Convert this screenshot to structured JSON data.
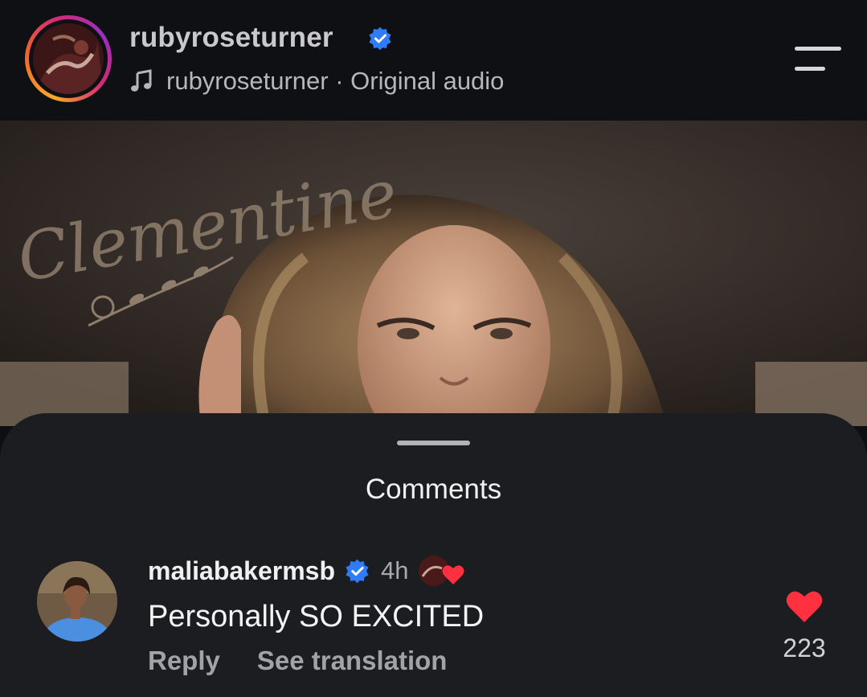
{
  "header": {
    "username": "rubyroseturner",
    "verified": true,
    "audio_label": "rubyroseturner · Original audio"
  },
  "media": {
    "overlay_text": "Clementine"
  },
  "comments": {
    "title": "Comments",
    "items": [
      {
        "username": "maliabakermsb",
        "verified": true,
        "time": "4h",
        "text": "Personally SO EXCITED",
        "actions": [
          "Reply",
          "See translation"
        ],
        "like_count": "223",
        "liked": true
      }
    ]
  },
  "colors": {
    "verified_blue": "#2f7cf6",
    "like_red": "#ff3040",
    "sheet_bg": "#1b1d21"
  },
  "icons": [
    "verified-badge-icon",
    "music-note-icon",
    "menu-icon",
    "heart-icon"
  ]
}
